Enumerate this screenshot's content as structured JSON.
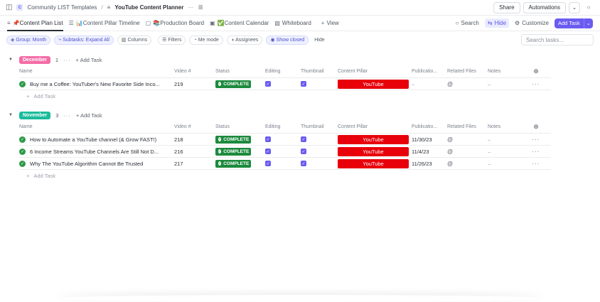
{
  "breadcrumb": {
    "workspace_badge": "C",
    "space": "Community LIST Templates",
    "separator": "/",
    "list": "YouTube Content Planner",
    "more": "···"
  },
  "topbar": {
    "share": "Share",
    "automations": "Automations"
  },
  "tabs": [
    {
      "label": "📌Content Plan List",
      "icon": "≡"
    },
    {
      "label": "📊Content Pillar Timeline",
      "icon": "☰"
    },
    {
      "label": "📚Production Board",
      "icon": "▢"
    },
    {
      "label": "✅Content Calendar",
      "icon": "▣"
    },
    {
      "label": "Whiteboard",
      "icon": "▧"
    },
    {
      "label": "View",
      "icon": "+"
    }
  ],
  "tabs_right": {
    "search": "Search",
    "hide": "Hide",
    "customize": "Customize",
    "add_task": "Add Task"
  },
  "filters": {
    "group": "Group: Month",
    "subtasks": "Subtasks: Expand All",
    "columns": "Columns",
    "filters": "Filters",
    "me_mode": "Me mode",
    "assignees": "Assignees",
    "show_closed": "Show closed",
    "hide": "Hide",
    "search_placeholder": "Search tasks..."
  },
  "columns": [
    "Name",
    "Video #",
    "Status",
    "Editing",
    "Thumbnail",
    "Content Pillar",
    "Publicatio...",
    "Related Files",
    "Notes"
  ],
  "groups": [
    {
      "name": "December",
      "color": "#f46da7",
      "count": "1",
      "add_task": "+ Add Task",
      "tasks": [
        {
          "name": "Buy me a Coffee: YouTuber's New Favorite Side Inco...",
          "video": "219",
          "status": "COMPLETE",
          "pillar": "YouTube",
          "pub": "–",
          "notes": "–"
        }
      ],
      "add_row": "Add Task"
    },
    {
      "name": "November",
      "color": "#1bbc9b",
      "count": "3",
      "add_task": "+ Add Task",
      "tasks": [
        {
          "name": "How to Automate a YouTube channel (& Grow FAST!)",
          "video": "218",
          "status": "COMPLETE",
          "pillar": "YouTube",
          "pub": "11/30/23",
          "notes": "–"
        },
        {
          "name": "6 Income Streams YouTube Channels Are Still Not D...",
          "video": "216",
          "status": "COMPLETE",
          "pillar": "YouTube",
          "pub": "11/4/23",
          "notes": "–"
        },
        {
          "name": "Why The YouTube Algorithm Cannot Be Trusted",
          "video": "217",
          "status": "COMPLETE",
          "pillar": "YouTube",
          "pub": "11/26/23",
          "notes": "–"
        }
      ],
      "add_row": "Add Task"
    }
  ],
  "colors": {
    "accent": "#6a5cf0",
    "complete": "#1d8a3d",
    "youtube": "#e8000b"
  }
}
